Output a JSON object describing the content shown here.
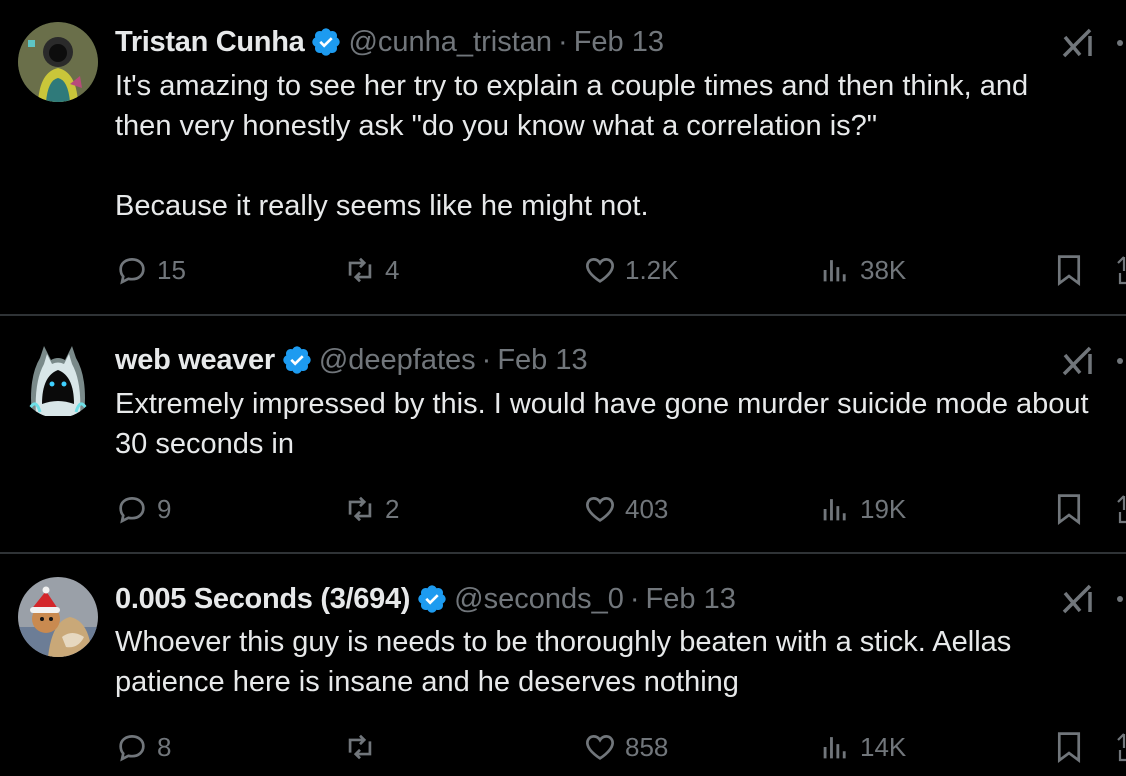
{
  "tweets": [
    {
      "name": "Tristan Cunha",
      "handle": "@cunha_tristan",
      "separator": "·",
      "date": "Feb 13",
      "text": [
        "It's amazing to see her try to explain a couple times and then think, and",
        "then very honestly ask \"do you know what a correlation is?\"",
        "",
        "Because it really seems like he might not."
      ],
      "replies": "15",
      "reposts": "4",
      "likes": "1.2K",
      "views": "38K"
    },
    {
      "name": "web weaver",
      "handle": "@deepfates",
      "separator": "·",
      "date": "Feb 13",
      "text": [
        "Extremely impressed by this. I would have gone murder suicide mode about",
        "30 seconds in"
      ],
      "replies": "9",
      "reposts": "2",
      "likes": "403",
      "views": "19K"
    },
    {
      "name": "0.005 Seconds (3/694)",
      "handle": "@seconds_0",
      "separator": "·",
      "date": "Feb 13",
      "text": [
        "Whoever this guy is needs to be thoroughly beaten with a stick. Aellas",
        "patience here is insane and he deserves nothing"
      ],
      "replies": "8",
      "reposts": "",
      "likes": "858",
      "views": "14K"
    }
  ],
  "colors": {
    "background": "#000000",
    "text": "#e7e9ea",
    "secondary": "#71767b",
    "verified": "#1d9bf0",
    "divider": "#2f3336"
  },
  "icons": {
    "verified": "verified-badge-icon",
    "grok": "grok-icon",
    "more": "more-options-icon",
    "reply": "reply-icon",
    "repost": "repost-icon",
    "like": "heart-icon",
    "views": "views-icon",
    "bookmark": "bookmark-icon",
    "share": "share-icon"
  }
}
